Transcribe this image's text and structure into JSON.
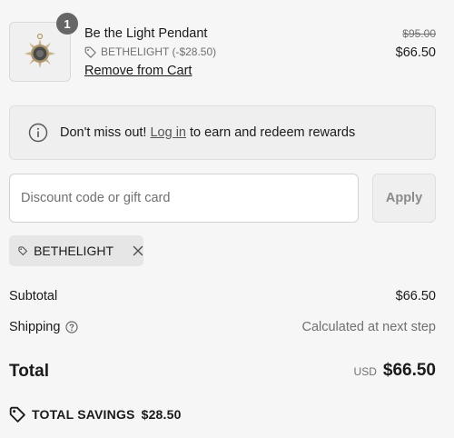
{
  "product": {
    "quantity": "1",
    "name": "Be the Light Pendant",
    "discount_code_label": "BETHELIGHT (-$28.50)",
    "remove_label": "Remove from Cart",
    "original_price": "$95.00",
    "price": "$66.50",
    "thumbnail_icon": "pendant-image"
  },
  "rewards": {
    "prefix": "Don't miss out!",
    "link": "Log in",
    "suffix": "to earn and redeem rewards",
    "icon": "info-icon"
  },
  "discount": {
    "placeholder": "Discount code or gift card",
    "apply_label": "Apply",
    "applied_code": "BETHELIGHT"
  },
  "summary": {
    "subtotal_label": "Subtotal",
    "subtotal_value": "$66.50",
    "shipping_label": "Shipping",
    "shipping_value": "Calculated at next step",
    "total_label": "Total",
    "currency": "USD",
    "total_value": "$66.50",
    "savings_label": "TOTAL SAVINGS",
    "savings_value": "$28.50"
  }
}
